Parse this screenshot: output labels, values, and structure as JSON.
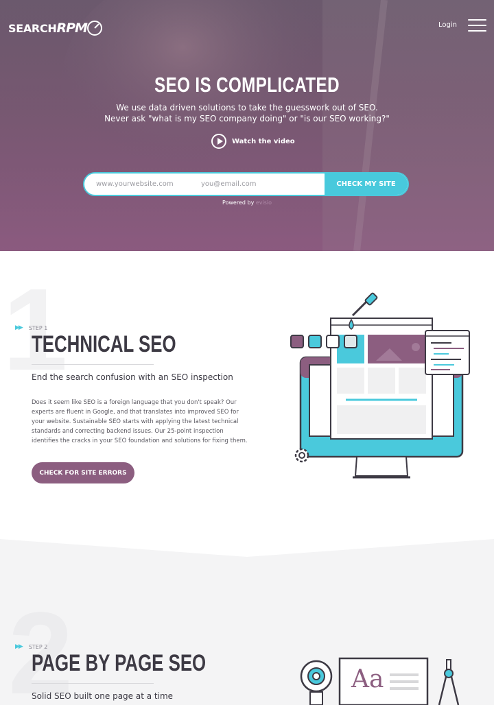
{
  "header": {
    "logo_text": "SEARCH",
    "logo_accent": "RPM",
    "login_label": "Login",
    "menu_icon": "hamburger-menu-icon"
  },
  "hero": {
    "title": "SEO IS COMPLICATED",
    "subtitle_line1": "We use data driven solutions to take the guesswork out of SEO.",
    "subtitle_line2": "Never ask \"what is my SEO company doing\" or \"is our SEO working?\"",
    "watch_label": "Watch the video",
    "website_placeholder": "www.yourwebsite.com",
    "email_placeholder": "you@email.com",
    "cta_label": "CHECK MY SITE",
    "powered_prefix": "Powered by",
    "powered_brand": "evisio"
  },
  "step1": {
    "number": "1",
    "tag": "STEP 1",
    "title": "TECHNICAL SEO",
    "subtitle": "End the search confusion with an SEO inspection",
    "body": "Does it seem like SEO is a foreign language that you don't speak? Our experts are fluent in Google, and that translates into improved SEO for your website. Sustainable SEO starts with applying the latest technical standards and correcting backend issues. Our 25-point inspection identifies the cracks in your SEO foundation and solutions for fixing them.",
    "cta_label": "CHECK FOR SITE ERRORS"
  },
  "step2": {
    "number": "2",
    "tag": "STEP 2",
    "title": "PAGE BY PAGE SEO",
    "subtitle": "Solid SEO built one page at a time",
    "illus_text": "Aa"
  },
  "colors": {
    "accent": "#48c9dc",
    "brand_purple": "#8c5e80",
    "dark": "#3d3a44"
  }
}
